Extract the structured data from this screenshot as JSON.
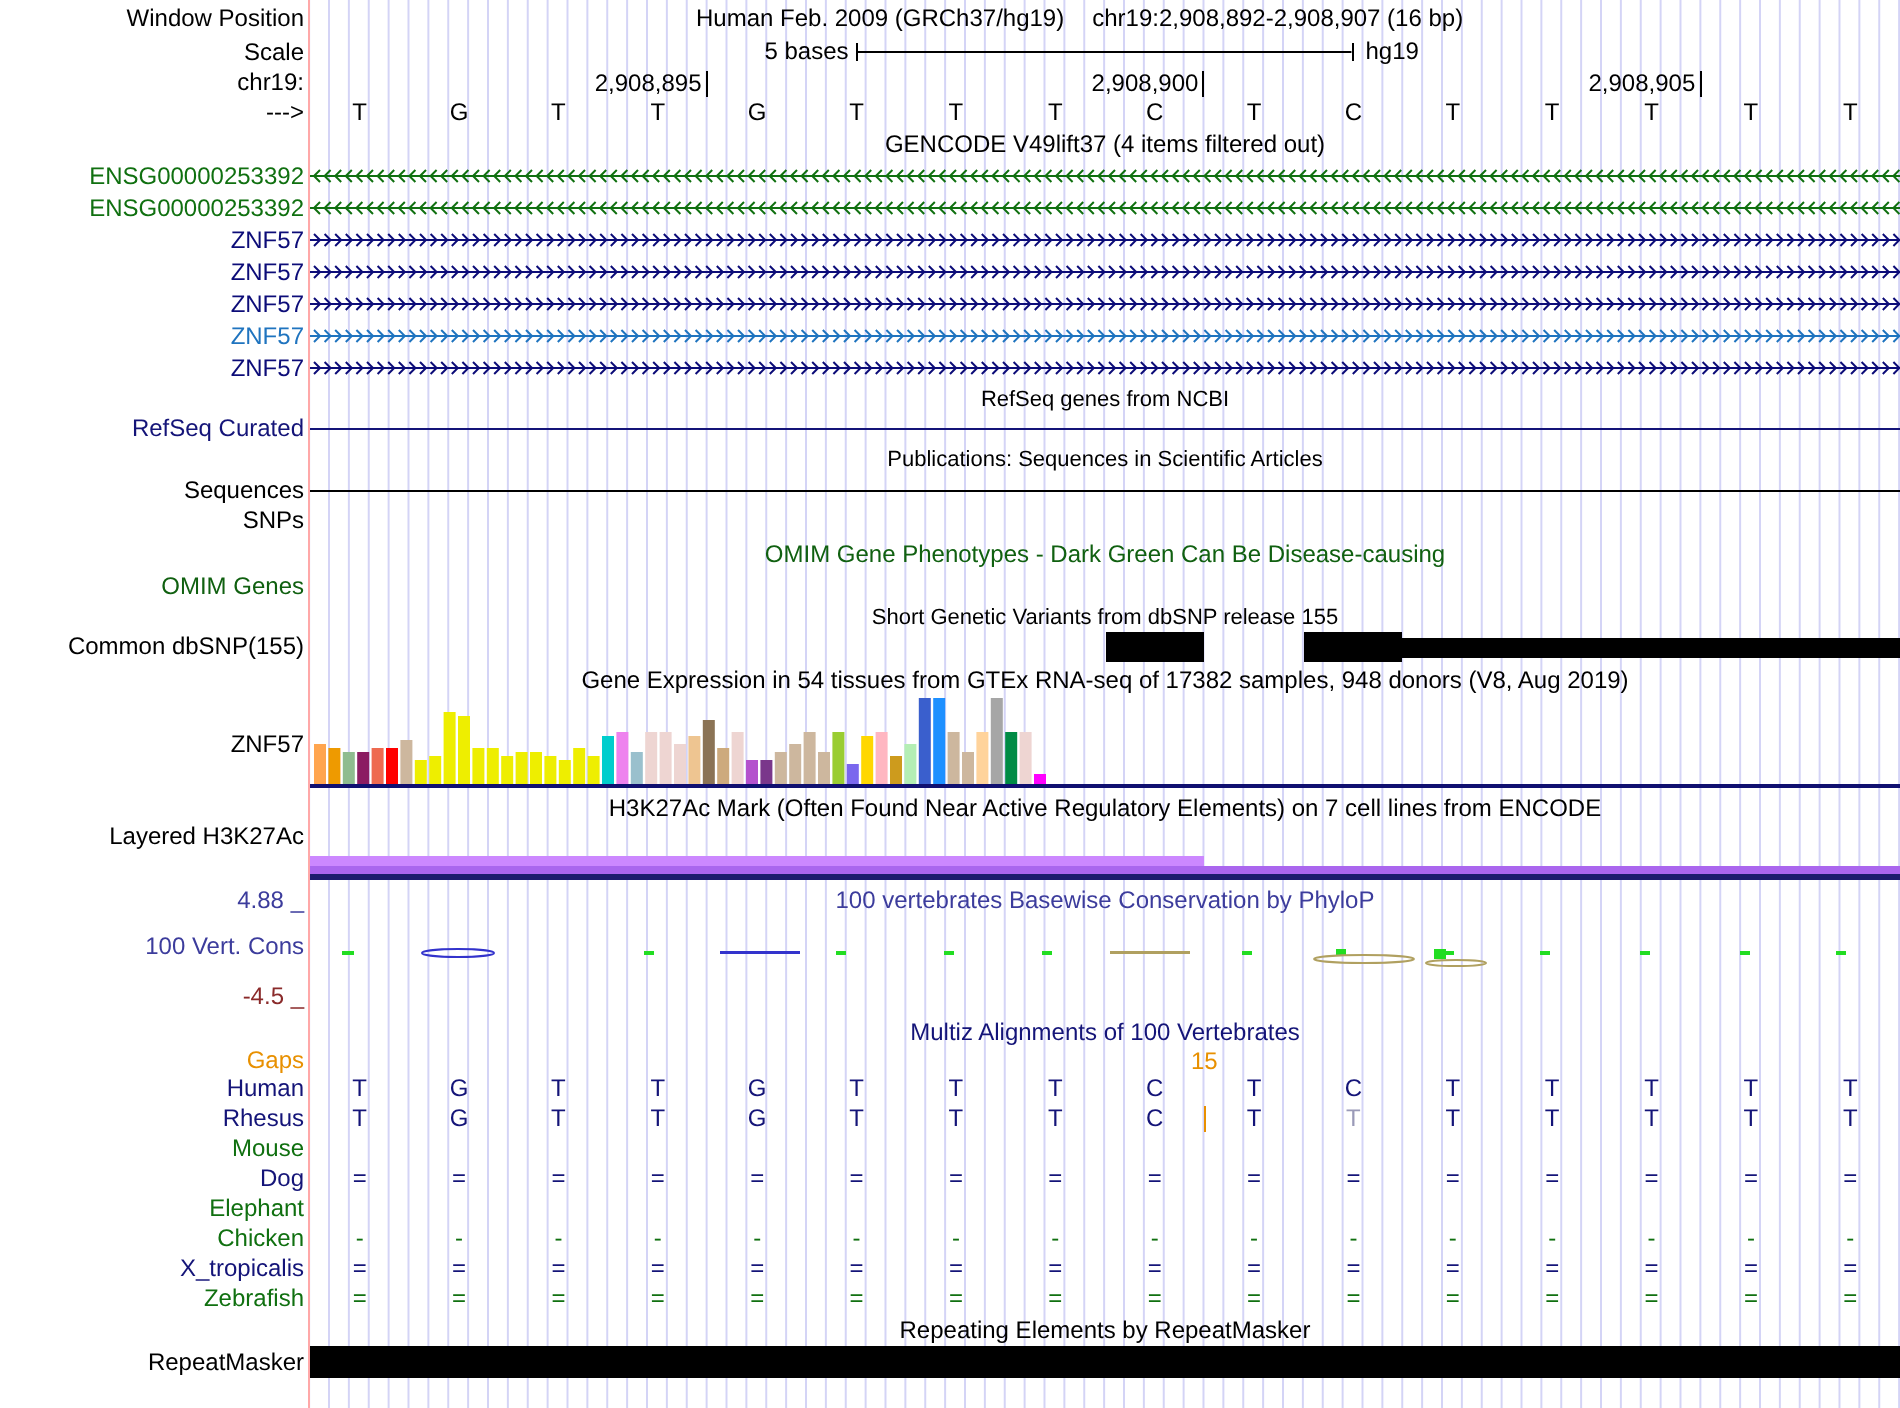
{
  "browser": {
    "window_position_label": "Window Position",
    "assembly_title": "Human Feb. 2009 (GRCh37/hg19)",
    "position_title": "chr19:2,908,892-2,908,907 (16 bp)"
  },
  "scale": {
    "label": "Scale",
    "span": "5 bases",
    "assembly": "hg19"
  },
  "coordinates": {
    "label": "chr19:",
    "ticks": [
      "2,908,895",
      "2,908,900",
      "2,908,905"
    ]
  },
  "sequence": {
    "label": "--->",
    "bases": [
      "T",
      "G",
      "T",
      "T",
      "G",
      "T",
      "T",
      "T",
      "C",
      "T",
      "C",
      "T",
      "T",
      "T",
      "T",
      "T"
    ]
  },
  "gencode": {
    "title": "GENCODE V49lift37 (4 items filtered out)",
    "genes": [
      {
        "name": "ENSG00000253392",
        "kind": "reverse",
        "color": "#107010"
      },
      {
        "name": "ENSG00000253392",
        "kind": "reverse",
        "color": "#107010"
      },
      {
        "name": "ZNF57",
        "kind": "forward",
        "color": "#0c0c78"
      },
      {
        "name": "ZNF57",
        "kind": "forward",
        "color": "#0c0c78"
      },
      {
        "name": "ZNF57",
        "kind": "forward",
        "color": "#0c0c78"
      },
      {
        "name": "ZNF57",
        "kind": "forward",
        "color": "#1f74bf"
      },
      {
        "name": "ZNF57",
        "kind": "forward",
        "color": "#0c0c78"
      }
    ]
  },
  "refseq": {
    "title": "RefSeq genes from NCBI",
    "label": "RefSeq Curated"
  },
  "publications": {
    "title": "Publications: Sequences in Scientific Articles",
    "label": "Sequences"
  },
  "snps": {
    "label": "SNPs"
  },
  "omim": {
    "title": "OMIM Gene Phenotypes - Dark Green Can Be Disease-causing",
    "label": "OMIM Genes"
  },
  "dbsnp": {
    "title": "Short Genetic Variants from dbSNP release 155",
    "label": "Common dbSNP(155)"
  },
  "gtex": {
    "title": "Gene Expression in 54 tissues from GTEx RNA-seq of 17382 samples, 948 donors (V8, Aug 2019)",
    "label": "ZNF57"
  },
  "h3k27ac": {
    "title": "H3K27Ac Mark (Often Found Near Active Regulatory Elements) on 7 cell lines from ENCODE",
    "label": "Layered H3K27Ac"
  },
  "phylop": {
    "title": "100 vertebrates Basewise Conservation by PhyloP",
    "label": "100 Vert. Cons",
    "max": "4.88 _",
    "min": "-4.5 _"
  },
  "multiz": {
    "title": "Multiz Alignments of 100 Vertebrates",
    "gaps_label": "Gaps",
    "gap_count": "15",
    "species": [
      {
        "name": "Human",
        "color": "#141478",
        "insertion": false,
        "cells": [
          {
            "base": "T",
            "faded": false
          },
          {
            "base": "G",
            "faded": false
          },
          {
            "base": "T",
            "faded": false
          },
          {
            "base": "T",
            "faded": false
          },
          {
            "base": "G",
            "faded": false
          },
          {
            "base": "T",
            "faded": false
          },
          {
            "base": "T",
            "faded": false
          },
          {
            "base": "T",
            "faded": false
          },
          {
            "base": "C",
            "faded": false
          },
          {
            "base": "T",
            "faded": false
          },
          {
            "base": "C",
            "faded": false
          },
          {
            "base": "T",
            "faded": false
          },
          {
            "base": "T",
            "faded": false
          },
          {
            "base": "T",
            "faded": false
          },
          {
            "base": "T",
            "faded": false
          },
          {
            "base": "T",
            "faded": false
          }
        ]
      },
      {
        "name": "Rhesus",
        "color": "#141478",
        "insertion": true,
        "cells": [
          {
            "base": "T",
            "faded": false
          },
          {
            "base": "G",
            "faded": false
          },
          {
            "base": "T",
            "faded": false
          },
          {
            "base": "T",
            "faded": false
          },
          {
            "base": "G",
            "faded": false
          },
          {
            "base": "T",
            "faded": false
          },
          {
            "base": "T",
            "faded": false
          },
          {
            "base": "T",
            "faded": false
          },
          {
            "base": "C",
            "faded": false
          },
          {
            "base": "T",
            "faded": false
          },
          {
            "base": "T",
            "faded": true
          },
          {
            "base": "T",
            "faded": false
          },
          {
            "base": "T",
            "faded": false
          },
          {
            "base": "T",
            "faded": false
          },
          {
            "base": "T",
            "faded": false
          },
          {
            "base": "T",
            "faded": false
          }
        ]
      },
      {
        "name": "Mouse",
        "color": "#107010",
        "insertion": false
      },
      {
        "name": "Dog",
        "color": "#141478",
        "insertion": false,
        "cells": [
          {
            "base": "=",
            "faded": false
          },
          {
            "base": "=",
            "faded": false
          },
          {
            "base": "=",
            "faded": false
          },
          {
            "base": "=",
            "faded": false
          },
          {
            "base": "=",
            "faded": false
          },
          {
            "base": "=",
            "faded": false
          },
          {
            "base": "=",
            "faded": false
          },
          {
            "base": "=",
            "faded": false
          },
          {
            "base": "=",
            "faded": false
          },
          {
            "base": "=",
            "faded": false
          },
          {
            "base": "=",
            "faded": false
          },
          {
            "base": "=",
            "faded": false
          },
          {
            "base": "=",
            "faded": false
          },
          {
            "base": "=",
            "faded": false
          },
          {
            "base": "=",
            "faded": false
          },
          {
            "base": "=",
            "faded": false
          }
        ]
      },
      {
        "name": "Elephant",
        "color": "#107010",
        "insertion": false
      },
      {
        "name": "Chicken",
        "color": "#107010",
        "insertion": false,
        "cells": [
          {
            "base": "-",
            "faded": false
          },
          {
            "base": "-",
            "faded": false
          },
          {
            "base": "-",
            "faded": false
          },
          {
            "base": "-",
            "faded": false
          },
          {
            "base": "-",
            "faded": false
          },
          {
            "base": "-",
            "faded": false
          },
          {
            "base": "-",
            "faded": false
          },
          {
            "base": "-",
            "faded": false
          },
          {
            "base": "-",
            "faded": false
          },
          {
            "base": "-",
            "faded": false
          },
          {
            "base": "-",
            "faded": false
          },
          {
            "base": "-",
            "faded": false
          },
          {
            "base": "-",
            "faded": false
          },
          {
            "base": "-",
            "faded": false
          },
          {
            "base": "-",
            "faded": false
          },
          {
            "base": "-",
            "faded": false
          }
        ]
      },
      {
        "name": "X_tropicalis",
        "color": "#141478",
        "insertion": false,
        "cells": [
          {
            "base": "=",
            "faded": false
          },
          {
            "base": "=",
            "faded": false
          },
          {
            "base": "=",
            "faded": false
          },
          {
            "base": "=",
            "faded": false
          },
          {
            "base": "=",
            "faded": false
          },
          {
            "base": "=",
            "faded": false
          },
          {
            "base": "=",
            "faded": false
          },
          {
            "base": "=",
            "faded": false
          },
          {
            "base": "=",
            "faded": false
          },
          {
            "base": "=",
            "faded": false
          },
          {
            "base": "=",
            "faded": false
          },
          {
            "base": "=",
            "faded": false
          },
          {
            "base": "=",
            "faded": false
          },
          {
            "base": "=",
            "faded": false
          },
          {
            "base": "=",
            "faded": false
          },
          {
            "base": "=",
            "faded": false
          }
        ]
      },
      {
        "name": "Zebrafish",
        "color": "#107010",
        "insertion": false,
        "cells": [
          {
            "base": "=",
            "faded": false
          },
          {
            "base": "=",
            "faded": false
          },
          {
            "base": "=",
            "faded": false
          },
          {
            "base": "=",
            "faded": false
          },
          {
            "base": "=",
            "faded": false
          },
          {
            "base": "=",
            "faded": false
          },
          {
            "base": "=",
            "faded": false
          },
          {
            "base": "=",
            "faded": false
          },
          {
            "base": "=",
            "faded": false
          },
          {
            "base": "=",
            "faded": false
          },
          {
            "base": "=",
            "faded": false
          },
          {
            "base": "=",
            "faded": false
          },
          {
            "base": "=",
            "faded": false
          },
          {
            "base": "=",
            "faded": false
          },
          {
            "base": "=",
            "faded": false
          },
          {
            "base": "=",
            "faded": false
          }
        ]
      }
    ]
  },
  "repeatmasker": {
    "title": "Repeating Elements by RepeatMasker",
    "label": "RepeatMasker"
  }
}
